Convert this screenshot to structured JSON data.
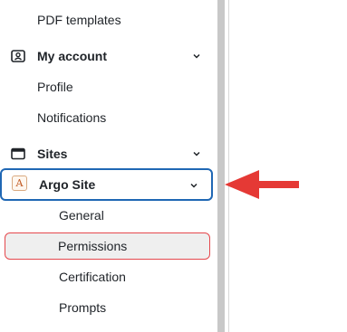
{
  "sidebar": {
    "pdf_templates": "PDF templates",
    "my_account": "My account",
    "profile": "Profile",
    "notifications": "Notifications",
    "sites": "Sites",
    "argo_site": "Argo Site",
    "argo_site_badge": "A",
    "general": "General",
    "permissions": "Permissions",
    "certification": "Certification",
    "prompts": "Prompts"
  },
  "colors": {
    "active_border": "#1f67b4",
    "highlight_border": "#e5484d",
    "arrow": "#e53935"
  },
  "icons": {
    "my_account": "user-card-icon",
    "sites": "browser-window-icon",
    "chevron": "chevron-down-icon",
    "annotation": "left-arrow-icon"
  }
}
